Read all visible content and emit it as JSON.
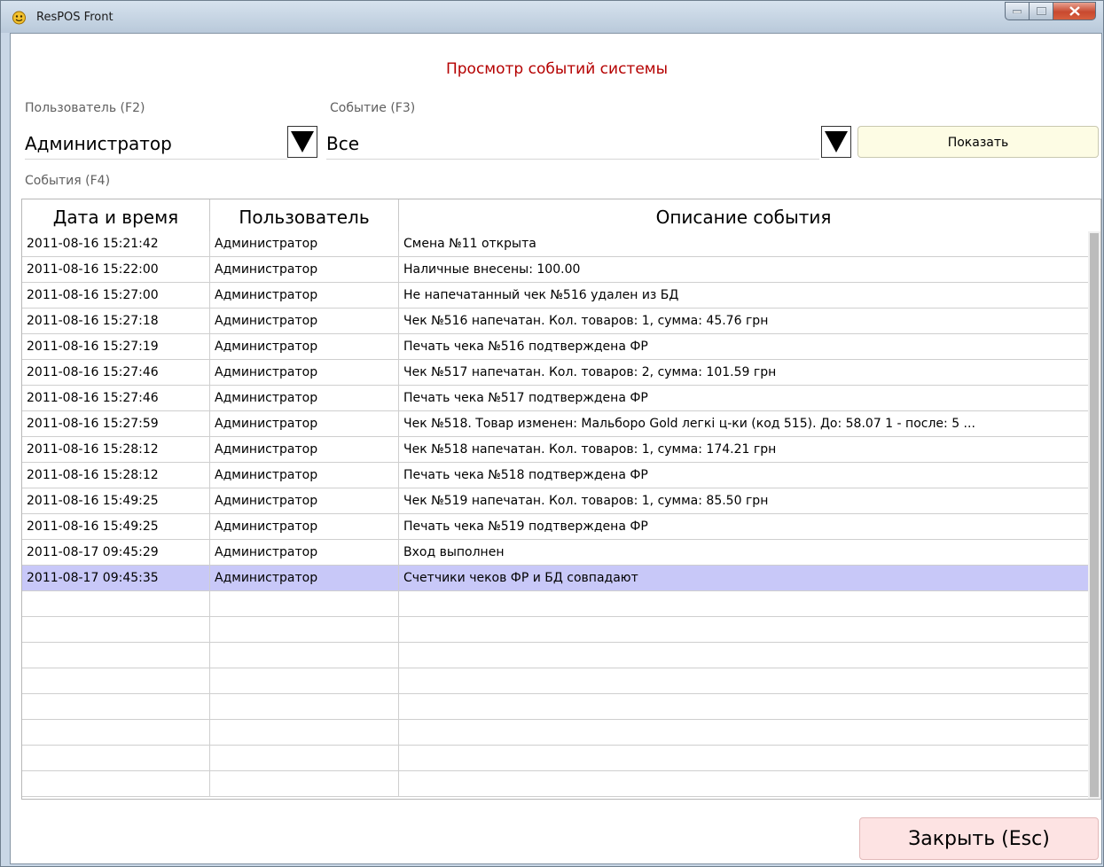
{
  "window": {
    "title": "ResPOS Front"
  },
  "page": {
    "title": "Просмотр событий системы"
  },
  "filters": {
    "user_label": "Пользователь (F2)",
    "user_value": "Администратор",
    "event_label": "Событие (F3)",
    "event_value": "Все",
    "show_button": "Показать",
    "events_label": "События (F4)"
  },
  "table": {
    "columns": [
      "Дата и время",
      "Пользователь",
      "Описание события"
    ],
    "rows": [
      [
        "2011-08-16 15:21:42",
        "Администратор",
        "Смена №11 открыта"
      ],
      [
        "2011-08-16 15:22:00",
        "Администратор",
        "Наличные внесены: 100.00"
      ],
      [
        "2011-08-16 15:27:00",
        "Администратор",
        "Не напечатанный чек №516 удален из БД"
      ],
      [
        "2011-08-16 15:27:18",
        "Администратор",
        "Чек №516 напечатан. Кол. товаров: 1, сумма: 45.76 грн"
      ],
      [
        "2011-08-16 15:27:19",
        "Администратор",
        "Печать чека №516 подтверждена ФР"
      ],
      [
        "2011-08-16 15:27:46",
        "Администратор",
        "Чек №517 напечатан. Кол. товаров: 2, сумма: 101.59 грн"
      ],
      [
        "2011-08-16 15:27:46",
        "Администратор",
        "Печать чека №517 подтверждена ФР"
      ],
      [
        "2011-08-16 15:27:59",
        "Администратор",
        "Чек №518. Товар изменен: Мальборо Gold легкі ц-ки (код 515). До: 58.07 1 - после: 5 ..."
      ],
      [
        "2011-08-16 15:28:12",
        "Администратор",
        "Чек №518 напечатан. Кол. товаров: 1, сумма: 174.21 грн"
      ],
      [
        "2011-08-16 15:28:12",
        "Администратор",
        "Печать чека №518 подтверждена ФР"
      ],
      [
        "2011-08-16 15:49:25",
        "Администратор",
        "Чек №519 напечатан. Кол. товаров: 1, сумма: 85.50 грн"
      ],
      [
        "2011-08-16 15:49:25",
        "Администратор",
        "Печать чека №519 подтверждена ФР"
      ],
      [
        "2011-08-17 09:45:29",
        "Администратор",
        "Вход выполнен"
      ],
      [
        "2011-08-17 09:45:35",
        "Администратор",
        "Счетчики чеков ФР и БД совпадают"
      ]
    ],
    "selected_index": 13,
    "empty_rows": 8
  },
  "footer": {
    "close_button": "Закрыть (Esc)"
  },
  "icons": [
    "app-icon",
    "minimize-icon",
    "maximize-icon",
    "close-icon",
    "dropdown-arrow-icon"
  ],
  "colors": {
    "title": "#b50000",
    "selection": "#c8c8f8",
    "show_button_bg": "#fdfce4",
    "close_button_bg": "#fde3e3"
  }
}
